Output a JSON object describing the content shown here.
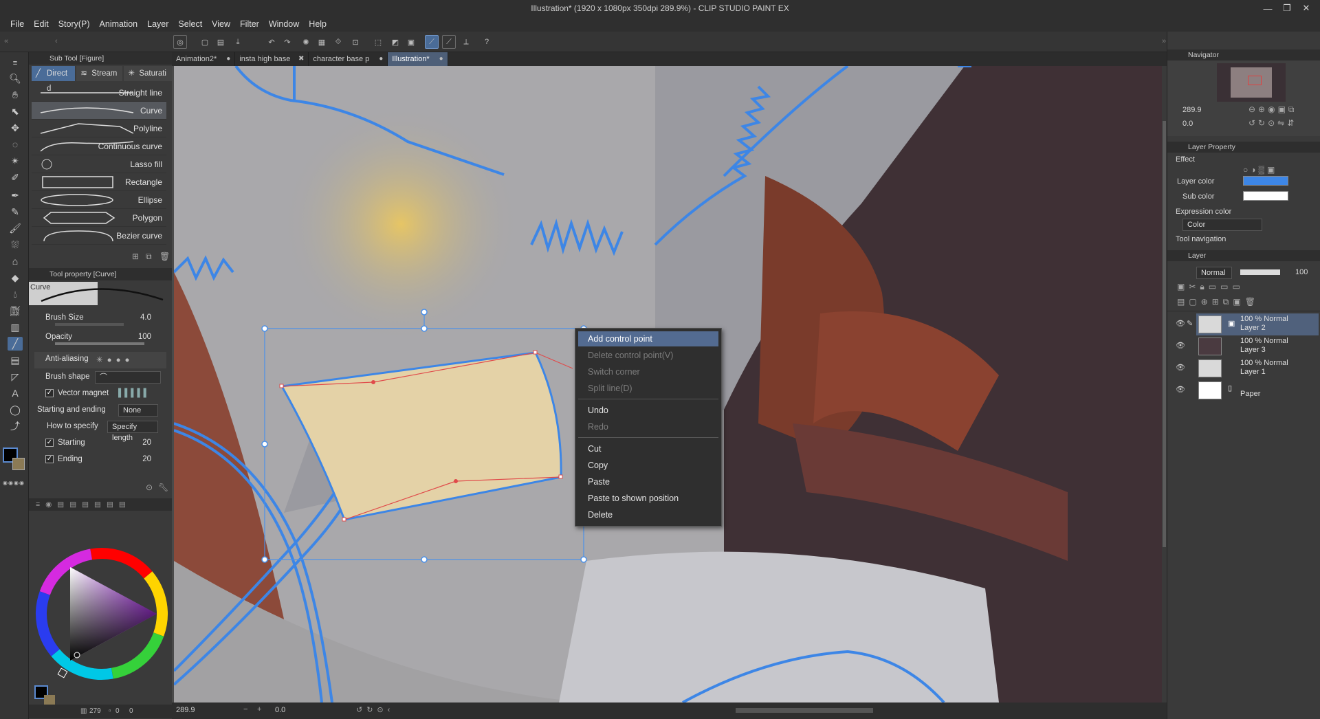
{
  "window": {
    "title": "Illustration* (1920 x 1080px 350dpi 289.9%)  - CLIP STUDIO PAINT EX"
  },
  "menu": [
    "File",
    "Edit",
    "Story(P)",
    "Animation",
    "Layer",
    "Select",
    "View",
    "Filter",
    "Window",
    "Help"
  ],
  "subtool_panel": {
    "header": "Sub Tool [Figure]",
    "tabs": [
      "Direct d",
      "Stream",
      "Saturati"
    ],
    "items": [
      "Straight line",
      "Curve",
      "Polyline",
      "Continuous curve",
      "Lasso fill",
      "Rectangle",
      "Ellipse",
      "Polygon",
      "Bezier curve"
    ],
    "selected": "Curve"
  },
  "tool_property": {
    "header": "Tool property [Curve]",
    "preview_label": "Curve",
    "brush_size_label": "Brush Size",
    "brush_size": "4.0",
    "opacity_label": "Opacity",
    "opacity": "100",
    "antialiasing_label": "Anti-aliasing",
    "brush_shape_label": "Brush shape",
    "vector_magnet_label": "Vector magnet",
    "starting_ending_label": "Starting and ending",
    "starting_ending_value": "None",
    "how_to_specify_label": "How to specify",
    "how_to_specify_value": "Specify length",
    "starting_label": "Starting",
    "starting_value": "20",
    "ending_label": "Ending",
    "ending_value": "20"
  },
  "document_tabs": [
    {
      "label": "Animation2*",
      "close": "●"
    },
    {
      "label": "insta high base",
      "close": "✖"
    },
    {
      "label": "character base p",
      "close": "●"
    },
    {
      "label": "Illustration*",
      "close": "●"
    }
  ],
  "status_bar": {
    "zoom": "289.9",
    "rotation": "0.0"
  },
  "color_status": {
    "mem": "279",
    "a": "0",
    "b": "0"
  },
  "context_menu": {
    "items": [
      {
        "label": "Add control point",
        "state": "highlighted"
      },
      {
        "label": "Delete control point(V)",
        "state": "disabled"
      },
      {
        "label": "Switch corner",
        "state": "disabled"
      },
      {
        "label": "Split line(D)",
        "state": "disabled"
      },
      {
        "label": "Undo",
        "state": "enabled"
      },
      {
        "label": "Redo",
        "state": "disabled"
      },
      {
        "label": "Cut",
        "state": "enabled"
      },
      {
        "label": "Copy",
        "state": "enabled"
      },
      {
        "label": "Paste",
        "state": "enabled"
      },
      {
        "label": "Paste to shown position",
        "state": "enabled"
      },
      {
        "label": "Delete",
        "state": "enabled"
      }
    ]
  },
  "navigator": {
    "header": "Navigator",
    "zoom": "289.9",
    "rotation": "0.0"
  },
  "layer_property": {
    "header": "Layer Property",
    "effect_label": "Effect",
    "layer_color_label": "Layer color",
    "layer_color": "#3d86e6",
    "sub_color_label": "Sub color",
    "sub_color": "#ffffff",
    "expression_color_label": "Expression color",
    "expression_color_value": "Color",
    "tool_navigation_label": "Tool navigation"
  },
  "layer_panel": {
    "header": "Layer",
    "blend_mode": "Normal",
    "opacity": "100",
    "layers": [
      {
        "line1": "100 % Normal",
        "line2": "Layer 2",
        "selected": true
      },
      {
        "line1": "100 % Normal",
        "line2": "Layer 3",
        "selected": false
      },
      {
        "line1": "100 % Normal",
        "line2": "Layer 1",
        "selected": false
      },
      {
        "line1": "",
        "line2": "Paper",
        "selected": false
      }
    ]
  },
  "colors": {
    "accent": "#4a6c98",
    "vector_line": "#3d86e6",
    "control_point": "#e04a4a"
  }
}
